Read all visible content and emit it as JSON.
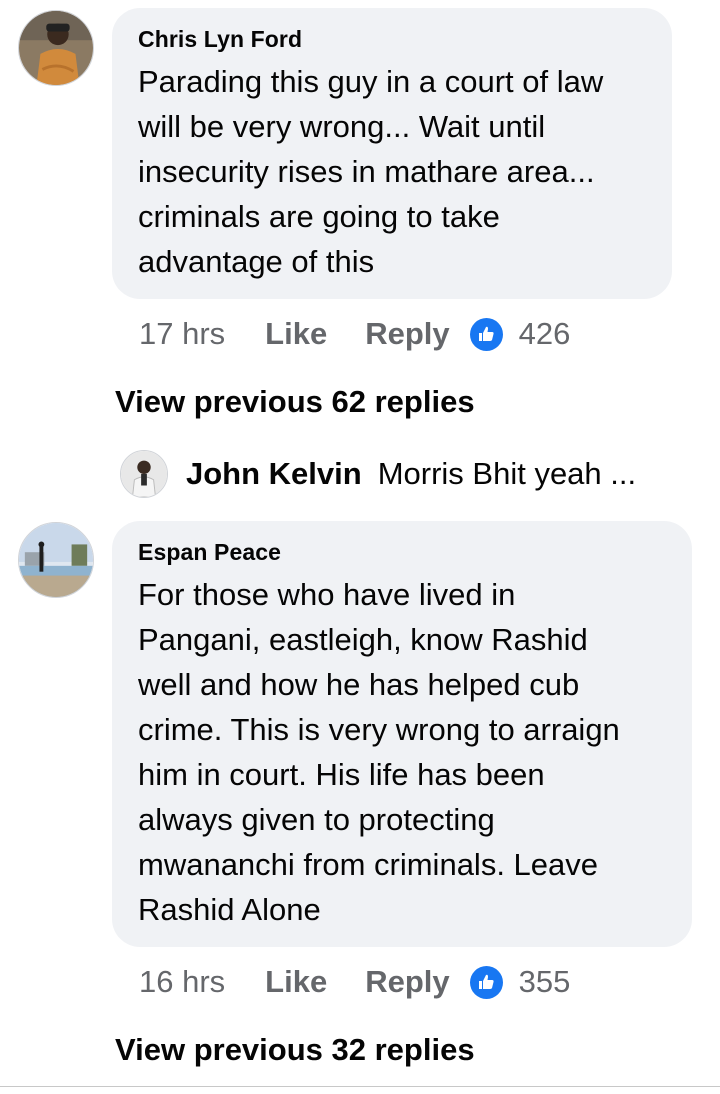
{
  "comments": [
    {
      "author": "Chris Lyn Ford",
      "text": "Parading this guy in a court of law will be very wrong... Wait until insecurity rises in mathare area... criminals are going to take advantage of this",
      "lines": [
        "Parading this guy in a court of law",
        "will be very wrong... Wait until",
        "insecurity rises in mathare area...",
        "criminals are going to take",
        "advantage of this"
      ],
      "time": "17 hrs",
      "like_label": "Like",
      "reply_label": "Reply",
      "reaction_count": "426",
      "view_previous": "View previous 62 replies",
      "latest_reply": {
        "name": "John Kelvin",
        "snippet": "Morris Bhit yeah ..."
      }
    },
    {
      "author": "Espan Peace",
      "text": "For those who have lived in Pangani, eastleigh, know Rashid well and how he has helped cub crime. This is very wrong to arraign him in court. His life has been always given to protecting mwananchi from criminals. Leave Rashid Alone",
      "lines": [
        "For those who have lived in",
        "Pangani, eastleigh, know Rashid",
        "well and how he has helped cub",
        "crime. This is very wrong to arraign",
        "him in court. His life has been",
        "always given to protecting",
        "mwananchi from criminals. Leave",
        "Rashid Alone"
      ],
      "time": "16 hrs",
      "like_label": "Like",
      "reply_label": "Reply",
      "reaction_count": "355",
      "view_previous": "View previous 32 replies"
    }
  ],
  "icons": {
    "reaction": "like-thumb-icon"
  },
  "colors": {
    "bubble": "#f0f2f5",
    "like_blue": "#1877f2",
    "meta_gray": "#65676b"
  }
}
